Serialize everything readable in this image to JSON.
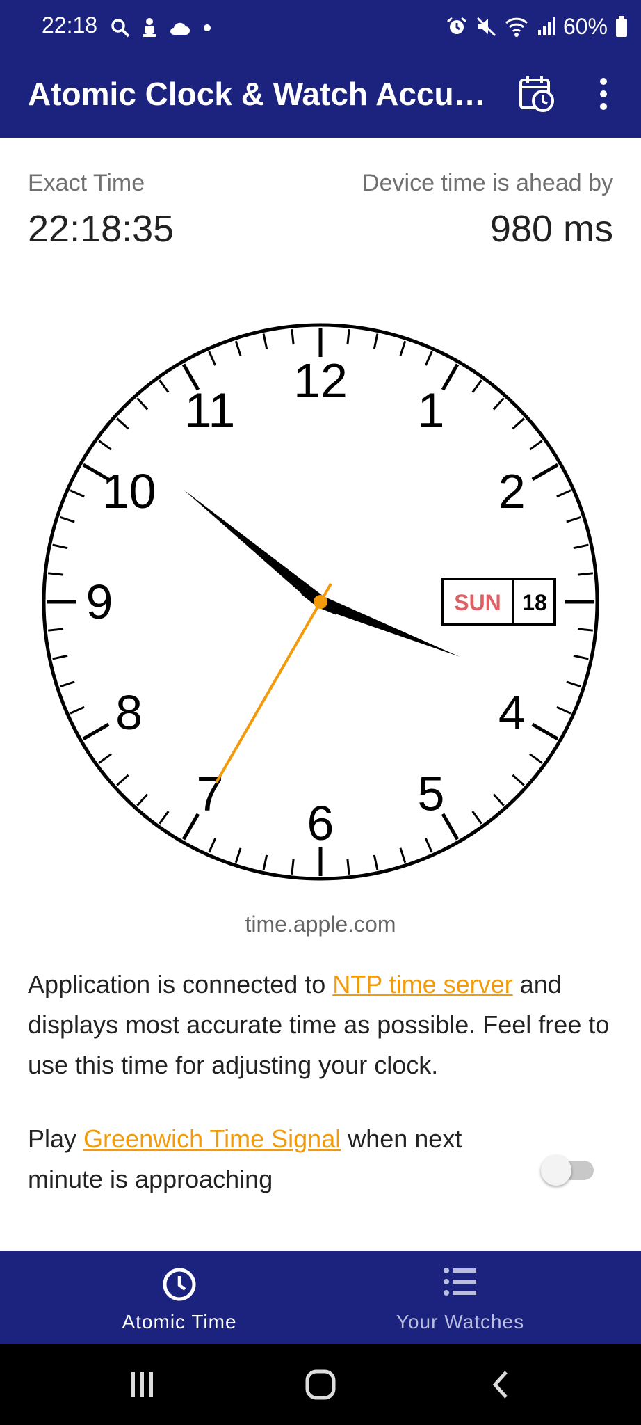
{
  "status_bar": {
    "time": "22:18",
    "battery": "60%",
    "left_icons": [
      "search-icon",
      "figure-icon",
      "cloud-icon",
      "dot-icon"
    ],
    "right_icons": [
      "alarm-icon",
      "mute-icon",
      "wifi-icon",
      "signal-icon",
      "battery-icon"
    ]
  },
  "app_bar": {
    "title": "Atomic Clock & Watch Accu…",
    "actions": [
      "calendar-clock-icon",
      "more-vert-icon"
    ]
  },
  "exact_time": {
    "label": "Exact Time",
    "value": "22:18:35"
  },
  "offset": {
    "label": "Device time is ahead by",
    "value": "980 ms"
  },
  "clock": {
    "numbers": [
      "12",
      "1",
      "2",
      "4",
      "5",
      "6",
      "7",
      "8",
      "9",
      "10",
      "11"
    ],
    "hours": 22,
    "minutes": 18,
    "seconds": 35,
    "date_day": "SUN",
    "date_num": "18",
    "second_hand_color": "#f29a09",
    "day_color": "#e05f64"
  },
  "server": "time.apple.com",
  "info": {
    "pre": "Application is connected to ",
    "link": "NTP time server",
    "post": " and displays most accurate time as possible. Feel free to use this time for adjusting your clock."
  },
  "signal": {
    "pre": "Play ",
    "link": "Greenwich Time Signal",
    "post": " when next minute is approaching",
    "toggle_on": false
  },
  "bottom_nav": {
    "items": [
      {
        "label": "Atomic Time",
        "icon": "clock-icon",
        "active": true
      },
      {
        "label": "Your Watches",
        "icon": "list-icon",
        "active": false
      }
    ]
  },
  "colors": {
    "primary": "#1b237e",
    "accent": "#f29a09"
  }
}
